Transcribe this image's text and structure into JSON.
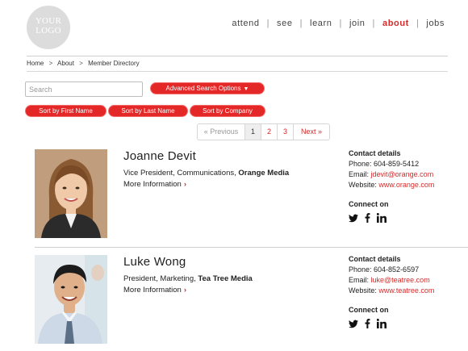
{
  "logo": {
    "line1": "YOUR",
    "line2": "LOGO"
  },
  "nav": {
    "items": [
      {
        "label": "attend"
      },
      {
        "label": "see"
      },
      {
        "label": "learn"
      },
      {
        "label": "join"
      },
      {
        "label": "about"
      },
      {
        "label": "jobs"
      }
    ],
    "separator": "|",
    "active": "about"
  },
  "breadcrumb": {
    "items": [
      "Home",
      "About",
      "Member Directory"
    ],
    "separator": ">"
  },
  "search": {
    "placeholder": "Search",
    "value": ""
  },
  "advanced_search": {
    "label": "Advanced Search Options",
    "icon": "chevron-down-icon"
  },
  "sort_buttons": [
    "Sort by First Name",
    "Sort by Last Name",
    "Sort by Company"
  ],
  "pagination": {
    "prev": "« Previous",
    "pages": [
      "1",
      "2",
      "3"
    ],
    "current": "1",
    "next": "Next »"
  },
  "colors": {
    "accent": "#e42727",
    "text": "#222222",
    "logo_bg": "#dcdcdc"
  },
  "members": [
    {
      "name": "Joanne Devit",
      "role": "Vice President, Communications, ",
      "company": "Orange Media",
      "more": "More Information",
      "contact_header": "Contact details",
      "phone_label": "Phone: ",
      "phone": "604-859-5412",
      "email_label": "Email: ",
      "email": "jdevit@orange.com",
      "website_label": "Website: ",
      "website": "www.orange.com",
      "connect": "Connect on",
      "social_icons": [
        "twitter-icon",
        "facebook-icon",
        "linkedin-icon"
      ]
    },
    {
      "name": "Luke Wong",
      "role": "President, Marketing, ",
      "company": "Tea Tree Media",
      "more": "More Information",
      "contact_header": "Contact details",
      "phone_label": "Phone: ",
      "phone": "604-852-6597",
      "email_label": "Email: ",
      "email": "luke@teatree.com",
      "website_label": "Website: ",
      "website": "www.teatree.com",
      "connect": "Connect on",
      "social_icons": [
        "twitter-icon",
        "facebook-icon",
        "linkedin-icon"
      ]
    }
  ]
}
